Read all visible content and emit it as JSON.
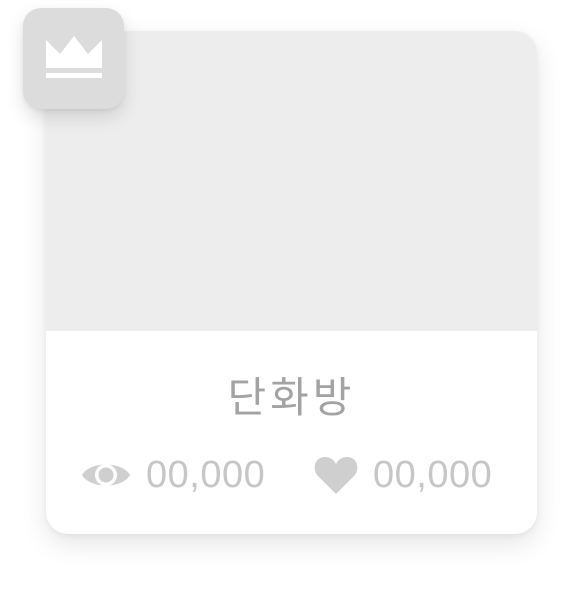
{
  "card": {
    "title": "단화방",
    "views": "00,000",
    "likes": "00,000"
  },
  "icons": {
    "badge": "crown-icon",
    "views": "eye-icon",
    "likes": "heart-icon"
  },
  "colors": {
    "thumbnail": "#ededed",
    "badge": "#dcdcdc",
    "title": "#a3a3a3",
    "stat": "#c6c6c6",
    "icon": "#cfcfcf"
  }
}
